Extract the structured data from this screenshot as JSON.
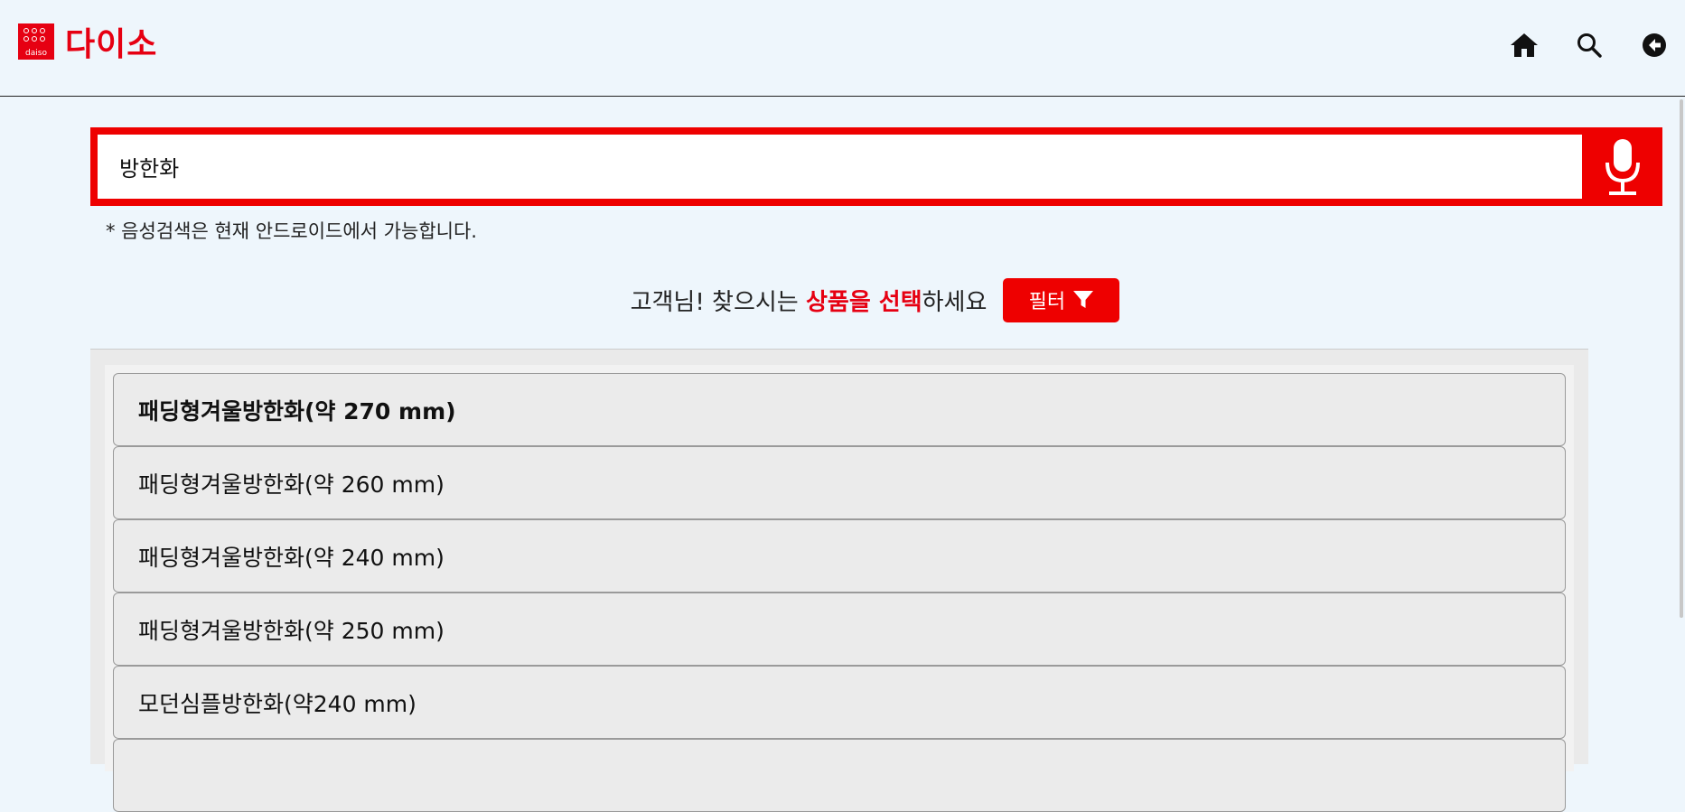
{
  "header": {
    "logo_mark_text": "daiso",
    "logo_text": "다이소",
    "brand_color": "#e60012",
    "icons": [
      "home-icon",
      "search-icon",
      "back-icon"
    ]
  },
  "search": {
    "value": "방한화",
    "voice_note": "* 음성검색은 현재 안드로이드에서 가능합니다."
  },
  "prompt": {
    "before": "고객님! 찾으시는 ",
    "highlight": "상품을 선택",
    "after": "하세요"
  },
  "filter": {
    "label": "필터",
    "icon": "filter-icon"
  },
  "results": [
    {
      "label": "패딩형겨울방한화(약 270 mm)",
      "selected": true
    },
    {
      "label": "패딩형겨울방한화(약 260 mm)",
      "selected": false
    },
    {
      "label": "패딩형겨울방한화(약 240 mm)",
      "selected": false
    },
    {
      "label": "패딩형겨울방한화(약 250 mm)",
      "selected": false
    },
    {
      "label": "모던심플방한화(약240 mm)",
      "selected": false
    },
    {
      "label": "",
      "selected": false
    }
  ]
}
